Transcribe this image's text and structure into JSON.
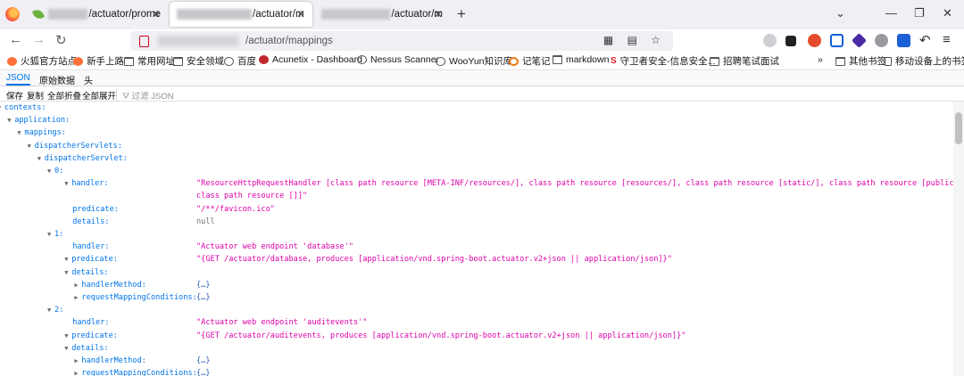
{
  "browser": {
    "tabs": [
      {
        "title_suffix": "/actuator/prome",
        "active": false
      },
      {
        "title_suffix": "/actuator/m",
        "active": true
      },
      {
        "title_suffix": "/actuator/m",
        "active": false
      }
    ],
    "url_path": "/actuator/mappings"
  },
  "bookmarks": [
    {
      "label": "火狐官方站点",
      "icon": "firefox-icon"
    },
    {
      "label": "新手上路",
      "icon": "firefox-icon"
    },
    {
      "label": "常用网址",
      "icon": "folder-icon"
    },
    {
      "label": "安全领域",
      "icon": "folder-icon"
    },
    {
      "label": "百度",
      "icon": "globe-icon"
    },
    {
      "label": "Acunetix - Dashboard",
      "icon": "acunetix-icon"
    },
    {
      "label": "Nessus Scanner",
      "icon": "globe-icon"
    },
    {
      "label": "WooYun知识库",
      "icon": "globe-icon"
    },
    {
      "label": "记笔记",
      "icon": "note-icon"
    },
    {
      "label": "markdown",
      "icon": "folder-icon"
    },
    {
      "label": "守卫者安全-信息安全...",
      "icon": "shield-icon"
    },
    {
      "label": "招聘笔试面试",
      "icon": "folder-icon"
    },
    {
      "label": "其他书签",
      "icon": "folder-icon"
    },
    {
      "label": "移动设备上的书签",
      "icon": "mobile-icon"
    }
  ],
  "json_viewer": {
    "tabs": [
      "JSON",
      "原始数据",
      "头"
    ],
    "tools": [
      "保存",
      "复制",
      "全部折叠",
      "全部展开"
    ],
    "filter_placeholder": "过滤 JSON"
  },
  "tree": [
    {
      "key": "contexts:",
      "level": 0,
      "twisty": true
    },
    {
      "key": "application:",
      "level": 1,
      "twisty": true
    },
    {
      "key": "mappings:",
      "level": 2,
      "twisty": true
    },
    {
      "key": "dispatcherServlets:",
      "level": 3,
      "twisty": true
    },
    {
      "key": "dispatcherServlet:",
      "level": 4,
      "twisty": true
    },
    {
      "key": "0:",
      "level": 5,
      "twisty": true
    },
    {
      "key": "handler:",
      "level": 6,
      "twisty": true,
      "value": "\"ResourceHttpRequestHandler [class path resource [META-INF/resources/], class path resource [resources/], class path resource [static/], class path resource [public/], ServletContext resour",
      "type": "str"
    },
    {
      "key": "",
      "level": 6,
      "twisty": false,
      "value": "class path resource []]\"",
      "type": "str"
    },
    {
      "key": "predicate:",
      "level": 6,
      "twisty": false,
      "value": "\"/**/favicon.ico\"",
      "type": "str"
    },
    {
      "key": "details:",
      "level": 6,
      "twisty": false,
      "value": "null",
      "type": "nul"
    },
    {
      "key": "1:",
      "level": 5,
      "twisty": true
    },
    {
      "key": "handler:",
      "level": 6,
      "twisty": false,
      "value": "\"Actuator web endpoint 'database'\"",
      "type": "str"
    },
    {
      "key": "predicate:",
      "level": 6,
      "twisty": true,
      "value": "\"{GET /actuator/database, produces [application/vnd.spring-boot.actuator.v2+json || application/json]}\"",
      "type": "str"
    },
    {
      "key": "details:",
      "level": 6,
      "twisty": true
    },
    {
      "key": "handlerMethod:",
      "level": 7,
      "twisty": "closed",
      "value": "{…}",
      "type": "obj"
    },
    {
      "key": "requestMappingConditions:",
      "level": 7,
      "twisty": "closed",
      "value": "{…}",
      "type": "obj"
    },
    {
      "key": "2:",
      "level": 5,
      "twisty": true
    },
    {
      "key": "handler:",
      "level": 6,
      "twisty": false,
      "value": "\"Actuator web endpoint 'auditevents'\"",
      "type": "str"
    },
    {
      "key": "predicate:",
      "level": 6,
      "twisty": true,
      "value": "\"{GET /actuator/auditevents, produces [application/vnd.spring-boot.actuator.v2+json || application/json]}\"",
      "type": "str"
    },
    {
      "key": "details:",
      "level": 6,
      "twisty": true
    },
    {
      "key": "handlerMethod:",
      "level": 7,
      "twisty": "closed",
      "value": "{…}",
      "type": "obj"
    },
    {
      "key": "requestMappingConditions:",
      "level": 7,
      "twisty": "closed",
      "value": "{…}",
      "type": "obj"
    }
  ]
}
